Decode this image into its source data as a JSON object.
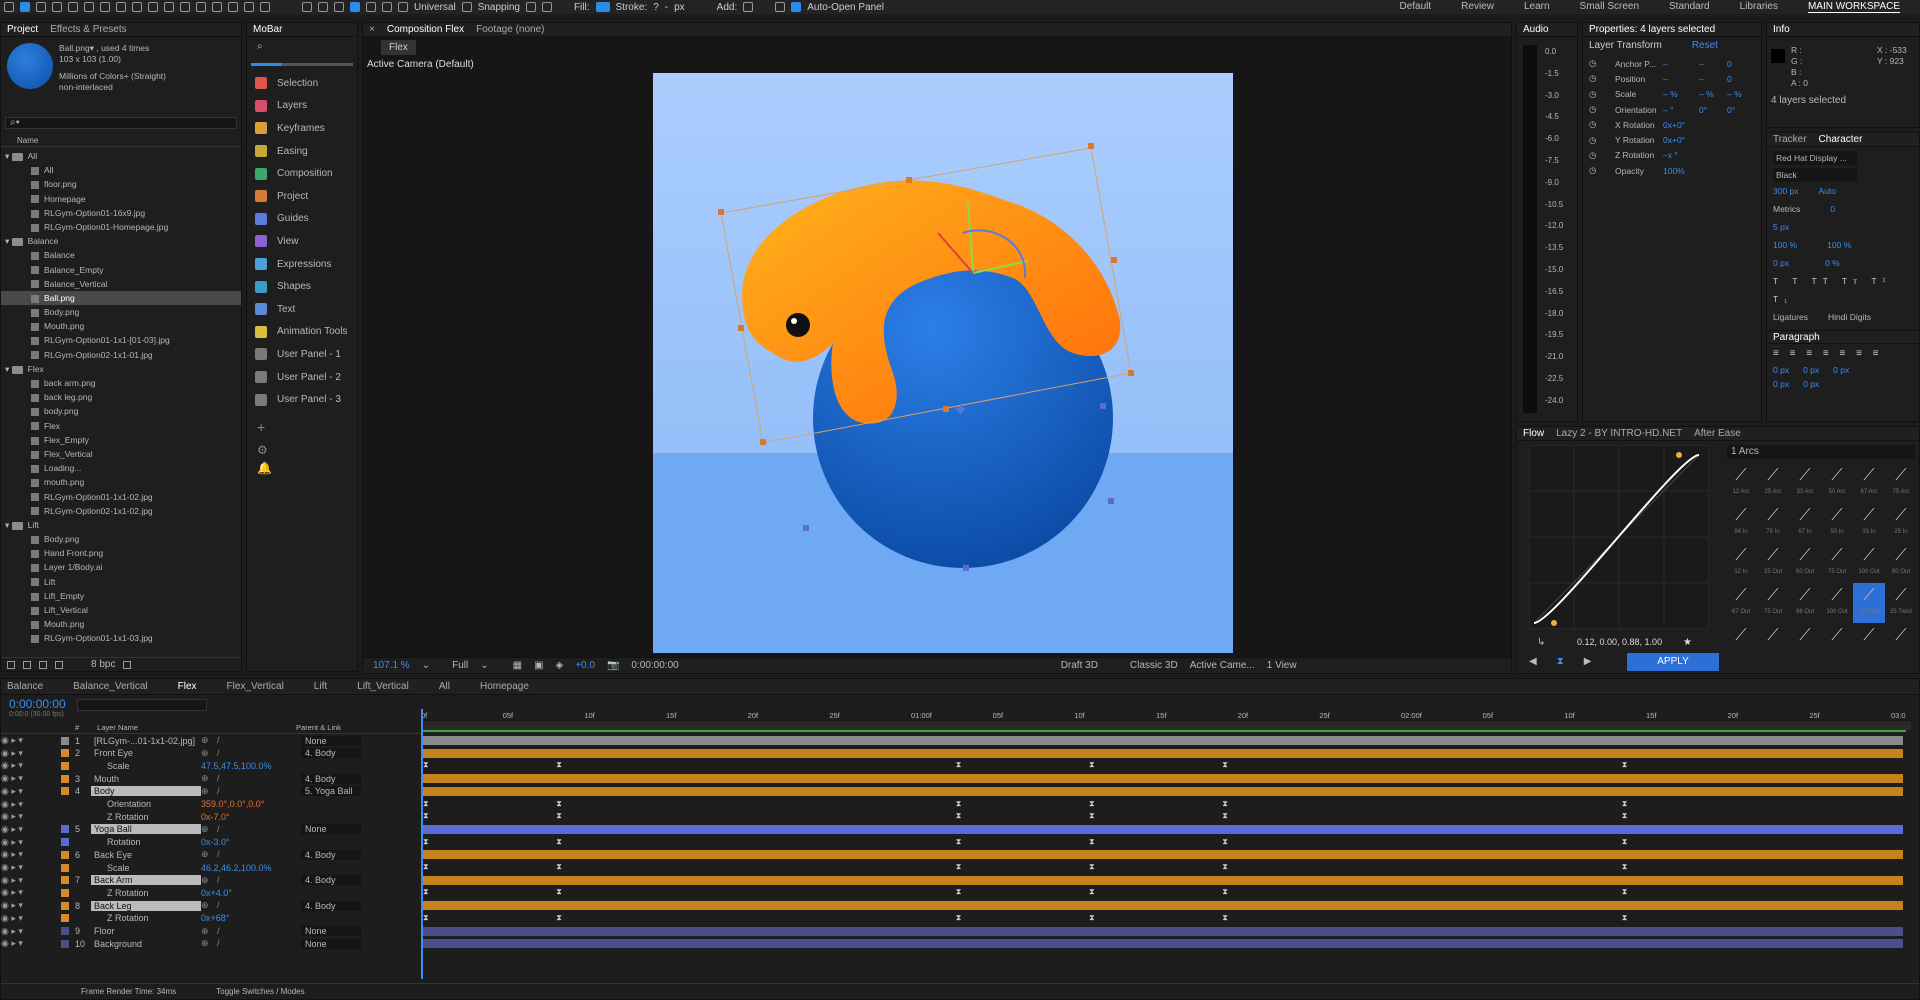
{
  "toolbar": {
    "universal": "Universal",
    "snapping": "Snapping",
    "fill": "Fill:",
    "stroke": "Stroke:",
    "stroke_value": "?",
    "px": "px",
    "add": "Add:",
    "auto_open": "Auto-Open Panel",
    "workspaces": [
      "Default",
      "Review",
      "Learn",
      "Small Screen",
      "Standard",
      "Libraries",
      "MAIN WORKSPACE"
    ]
  },
  "project": {
    "tabs": [
      "Project",
      "Effects & Presets"
    ],
    "file_name": "Ball.png▾ , used 4 times",
    "file_size": "103 x 103 (1.00)",
    "file_color": "Millions of Colors+ (Straight)",
    "file_interlace": "non-interlaced",
    "search_placeholder": "⌕▾",
    "col_name": "Name",
    "items": [
      {
        "t": "folder",
        "n": "All",
        "d": 0
      },
      {
        "t": "file",
        "n": "All",
        "d": 1
      },
      {
        "t": "file",
        "n": "floor.png",
        "d": 1
      },
      {
        "t": "file",
        "n": "Homepage",
        "d": 1
      },
      {
        "t": "file",
        "n": "RLGym-Option01-16x9.jpg",
        "d": 1
      },
      {
        "t": "file",
        "n": "RLGym-Option01-Homepage.jpg",
        "d": 1
      },
      {
        "t": "folder",
        "n": "Balance",
        "d": 0
      },
      {
        "t": "file",
        "n": "Balance",
        "d": 1
      },
      {
        "t": "file",
        "n": "Balance_Empty",
        "d": 1
      },
      {
        "t": "file",
        "n": "Balance_Vertical",
        "d": 1
      },
      {
        "t": "file",
        "n": "Ball.png",
        "d": 1,
        "sel": true
      },
      {
        "t": "file",
        "n": "Body.png",
        "d": 1
      },
      {
        "t": "file",
        "n": "Mouth.png",
        "d": 1
      },
      {
        "t": "file",
        "n": "RLGym-Option01-1x1-[01-03].jpg",
        "d": 1
      },
      {
        "t": "file",
        "n": "RLGym-Option02-1x1-01.jpg",
        "d": 1
      },
      {
        "t": "folder",
        "n": "Flex",
        "d": 0
      },
      {
        "t": "file",
        "n": "back arm.png",
        "d": 1
      },
      {
        "t": "file",
        "n": "back leg.png",
        "d": 1
      },
      {
        "t": "file",
        "n": "body.png",
        "d": 1
      },
      {
        "t": "file",
        "n": "Flex",
        "d": 1
      },
      {
        "t": "file",
        "n": "Flex_Empty",
        "d": 1
      },
      {
        "t": "file",
        "n": "Flex_Vertical",
        "d": 1
      },
      {
        "t": "file",
        "n": "Loading...",
        "d": 1
      },
      {
        "t": "file",
        "n": "mouth.png",
        "d": 1
      },
      {
        "t": "file",
        "n": "RLGym-Option01-1x1-02.jpg",
        "d": 1
      },
      {
        "t": "file",
        "n": "RLGym-Option02-1x1-02.jpg",
        "d": 1
      },
      {
        "t": "folder",
        "n": "Lift",
        "d": 0
      },
      {
        "t": "file",
        "n": "Body.png",
        "d": 1
      },
      {
        "t": "file",
        "n": "Hand Front.png",
        "d": 1
      },
      {
        "t": "file",
        "n": "Layer 1/Body.ai",
        "d": 1
      },
      {
        "t": "file",
        "n": "Lift",
        "d": 1
      },
      {
        "t": "file",
        "n": "Lift_Empty",
        "d": 1
      },
      {
        "t": "file",
        "n": "Lift_Vertical",
        "d": 1
      },
      {
        "t": "file",
        "n": "Mouth.png",
        "d": 1
      },
      {
        "t": "file",
        "n": "RLGym-Option01-1x1-03.jpg",
        "d": 1
      }
    ],
    "bpc": "8 bpc"
  },
  "mobar": {
    "title": "MoBar",
    "items": [
      "Selection",
      "Layers",
      "Keyframes",
      "Easing",
      "Composition",
      "Project",
      "Guides",
      "View",
      "Expressions",
      "Shapes",
      "Text",
      "Animation Tools",
      "User Panel - 1",
      "User Panel - 2",
      "User Panel - 3"
    ],
    "colors": [
      "#e0544a",
      "#d84e6b",
      "#d6a03a",
      "#c3a93a",
      "#3ea66b",
      "#d87b3a",
      "#5a7be0",
      "#8a62d6",
      "#4aa3d6",
      "#3a9ec3",
      "#5a8ad6",
      "#d6c03a",
      "#7a7a7a",
      "#7a7a7a",
      "#7a7a7a"
    ]
  },
  "composition": {
    "tab": "Composition Flex",
    "footage": "Footage (none)",
    "subtab": "Flex",
    "camera": "Active Camera (Default)",
    "zoom": "107.1 %",
    "resolution": "Full",
    "exposure": "+0.0",
    "timecode": "0:00:00:00",
    "draft": "Draft 3D",
    "renderer": "Classic 3D",
    "camera_select": "Active Came...",
    "views": "1 View"
  },
  "audio": {
    "title": "Audio",
    "levels": [
      "0.0",
      "-1.5",
      "-3.0",
      "-4.5",
      "-6.0",
      "-7.5",
      "-9.0",
      "-10.5",
      "-12.0",
      "-13.5",
      "-15.0",
      "-16.5",
      "-18.0",
      "-19.5",
      "-21.0",
      "-22.5",
      "-24.0"
    ]
  },
  "properties": {
    "title": "Properties: 4 layers selected",
    "section": "Layer Transform",
    "reset": "Reset",
    "rows": [
      {
        "name": "Anchor P...",
        "v1": "–",
        "v2": "–",
        "v3": "0"
      },
      {
        "name": "Position",
        "v1": "–",
        "v2": "–",
        "v3": "0"
      },
      {
        "name": "Scale",
        "v1": "– %",
        "v2": "– %",
        "v3": "– %"
      },
      {
        "name": "Orientation",
        "v1": "– °",
        "v2": "0°",
        "v3": "0°"
      },
      {
        "name": "X Rotation",
        "v1": "0x+0°",
        "v2": "",
        "v3": ""
      },
      {
        "name": "Y Rotation",
        "v1": "0x+0°",
        "v2": "",
        "v3": ""
      },
      {
        "name": "Z Rotation",
        "v1": "–x °",
        "v2": "",
        "v3": ""
      },
      {
        "name": "Opacity",
        "v1": "100%",
        "v2": "",
        "v3": ""
      }
    ]
  },
  "info": {
    "title": "Info",
    "r": "R :",
    "g": "G :",
    "b": "B :",
    "a": "A : 0",
    "x": "X : -533",
    "y": "Y : 923",
    "selected": "4 layers selected"
  },
  "character": {
    "tabs": [
      "Tracker",
      "Character"
    ],
    "font": "Red Hat Display ...",
    "style": "Black",
    "size": "300 px",
    "leading": "Auto",
    "kerning": "Metrics",
    "tracking": "0",
    "stroke_w": "5 px",
    "vscale": "100 %",
    "hscale": "100 %",
    "baseline": "0 px",
    "tsume": "0 %",
    "ligatures": "Ligatures",
    "hindi": "Hindi Digits",
    "paragraph": "Paragraph",
    "indents": [
      "0 px",
      "0 px",
      "0 px",
      "0 px",
      "0 px"
    ]
  },
  "flow": {
    "tabs": [
      "Flow",
      "Lazy 2 - BY INTRO-HD.NET",
      "After Ease"
    ],
    "values": "0.12, 0.00, 0.88, 1.00",
    "preset": "1 Arcs",
    "apply": "APPLY",
    "presets": [
      "12 Arc",
      "25 Arc",
      "33 Arc",
      "50 Arc",
      "67 Arc",
      "75 Arc",
      "84 In",
      "75 In",
      "67 In",
      "50 In",
      "33 In",
      "25 In",
      "12 In",
      "25 Out",
      "50 Out",
      "75 Out",
      "100 Out",
      "80 Out",
      "67 Out",
      "75 Out",
      "88 Out",
      "100 Out",
      "12 Twist",
      "25 Twist",
      "",
      "",
      "",
      "",
      "",
      ""
    ]
  },
  "timeline": {
    "tabs": [
      "Balance",
      "Balance_Vertical",
      "Flex",
      "Flex_Vertical",
      "Lift",
      "Lift_Vertical",
      "All",
      "Homepage"
    ],
    "timecode": "0:00:00:00",
    "fps": "0:00:0 (30.00 fps)",
    "cols": {
      "num": "#",
      "name": "Layer Name",
      "parent": "Parent & Link"
    },
    "ruler": [
      "0f",
      "05f",
      "10f",
      "15f",
      "20f",
      "25f",
      "01:00f",
      "05f",
      "10f",
      "15f",
      "20f",
      "25f",
      "02:00f",
      "05f",
      "10f",
      "15f",
      "20f",
      "25f",
      "03:0"
    ],
    "layers": [
      {
        "n": "1",
        "name": "[RLGym-...01-1x1-02.jpg]",
        "parent": "None",
        "c": "#8a8a8a",
        "prop": false
      },
      {
        "n": "2",
        "name": "Front Eye",
        "parent": "4. Body",
        "c": "#d68a2a",
        "prop": false
      },
      {
        "n": "",
        "name": "Scale",
        "val": "47.5,47.5,100.0%",
        "c": "#d68a2a",
        "prop": true
      },
      {
        "n": "3",
        "name": "Mouth",
        "parent": "4. Body",
        "c": "#d68a2a",
        "prop": false
      },
      {
        "n": "4",
        "name": "Body",
        "parent": "5. Yoga Ball",
        "c": "#d68a2a",
        "prop": false
      },
      {
        "n": "",
        "name": "Orientation",
        "val": "359.0°,0.0°,0.0°",
        "c": "",
        "prop": true
      },
      {
        "n": "",
        "name": "Z Rotation",
        "val": "0x-7.0°",
        "c": "",
        "prop": true
      },
      {
        "n": "5",
        "name": "Yoga Ball",
        "parent": "None",
        "c": "#5a6ad6",
        "prop": false
      },
      {
        "n": "",
        "name": "Rotation",
        "val": "0x-3.0°",
        "c": "#5a6ad6",
        "prop": true
      },
      {
        "n": "6",
        "name": "Back Eye",
        "parent": "4. Body",
        "c": "#d68a2a",
        "prop": false
      },
      {
        "n": "",
        "name": "Scale",
        "val": "46.2,46.2,100.0%",
        "c": "#d68a2a",
        "prop": true
      },
      {
        "n": "7",
        "name": "Back Arm",
        "parent": "4. Body",
        "c": "#d68a2a",
        "prop": false
      },
      {
        "n": "",
        "name": "Z Rotation",
        "val": "0x+4.0°",
        "c": "#d68a2a",
        "prop": true
      },
      {
        "n": "8",
        "name": "Back Leg",
        "parent": "4. Body",
        "c": "#d68a2a",
        "prop": false
      },
      {
        "n": "",
        "name": "Z Rotation",
        "val": "0x+68°",
        "c": "#d68a2a",
        "prop": true
      },
      {
        "n": "9",
        "name": "Floor",
        "parent": "None",
        "c": "#4a4e8a",
        "prop": false
      },
      {
        "n": "10",
        "name": "Background",
        "parent": "None",
        "c": "#4a4e8a",
        "prop": false
      }
    ],
    "render_time": "Frame Render Time: 34ms",
    "toggle": "Toggle Switches / Modes"
  }
}
